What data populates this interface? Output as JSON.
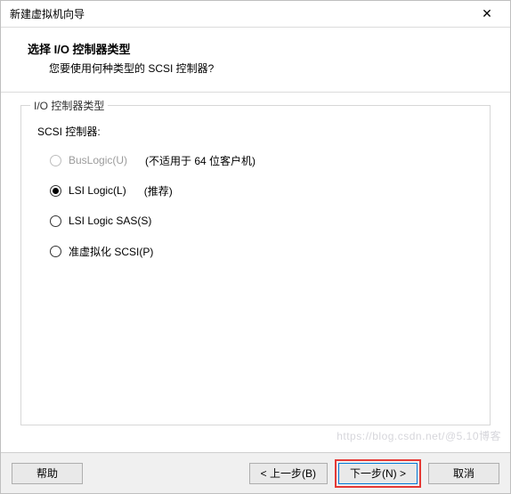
{
  "window": {
    "title": "新建虚拟机向导",
    "close_glyph": "✕"
  },
  "header": {
    "title": "选择 I/O 控制器类型",
    "subtitle": "您要使用何种类型的 SCSI 控制器?"
  },
  "group": {
    "legend": "I/O 控制器类型",
    "scsi_label": "SCSI 控制器:"
  },
  "options": {
    "buslogic": {
      "label": "BusLogic(U)",
      "hint": "(不适用于 64 位客户机)",
      "enabled": false,
      "selected": false
    },
    "lsi": {
      "label": "LSI Logic(L)",
      "hint": "(推荐)",
      "enabled": true,
      "selected": true
    },
    "lsisas": {
      "label": "LSI Logic SAS(S)",
      "hint": "",
      "enabled": true,
      "selected": false
    },
    "paravirt": {
      "label": "准虚拟化 SCSI(P)",
      "hint": "",
      "enabled": true,
      "selected": false
    }
  },
  "footer": {
    "help": "帮助",
    "back": "< 上一步(B)",
    "next": "下一步(N) >",
    "cancel": "取消"
  },
  "watermark": "https://blog.csdn.net/@5.10博客"
}
